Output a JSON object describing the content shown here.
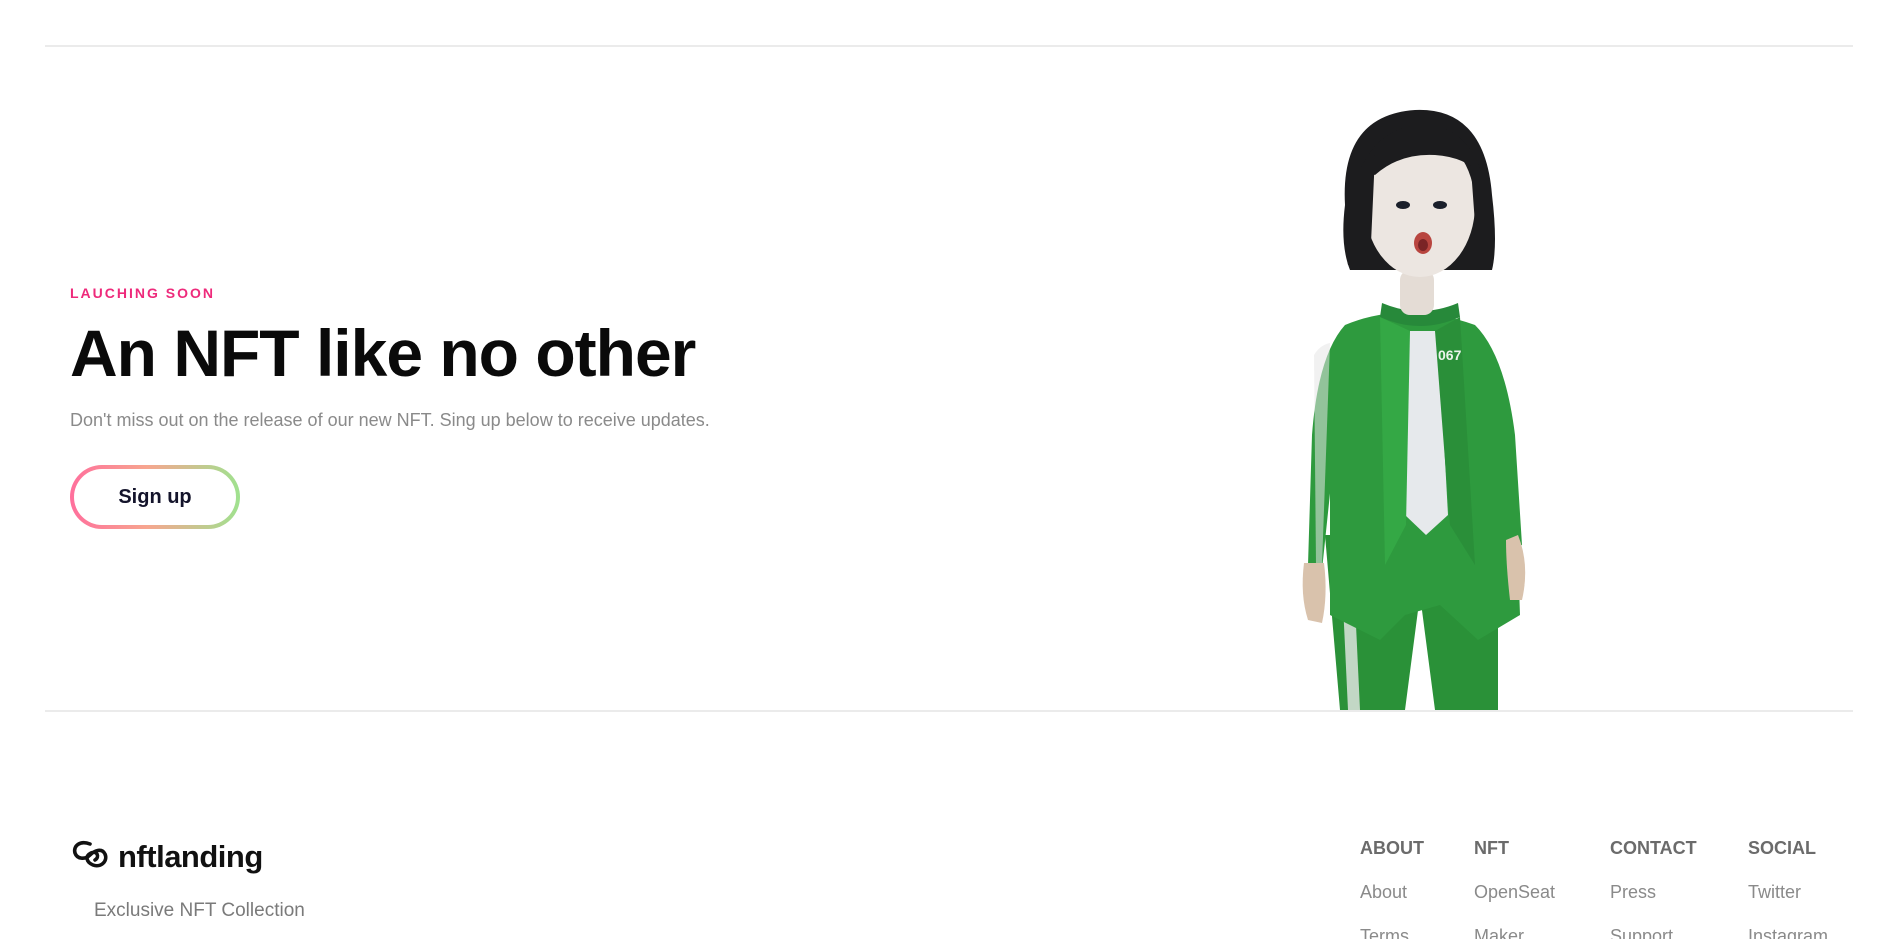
{
  "hero": {
    "eyebrow": "LAUCHING SOON",
    "headline": "An NFT like no other",
    "subtext": "Don't miss out on the release of our new NFT. Sing up below to receive updates.",
    "cta_label": "Sign up",
    "figure_badge": "067"
  },
  "footer": {
    "brand": "nftlanding",
    "tagline": "Exclusive NFT Collection",
    "columns": [
      {
        "heading": "ABOUT",
        "links": [
          "About",
          "Terms"
        ]
      },
      {
        "heading": "NFT",
        "links": [
          "OpenSeat",
          "Maker"
        ]
      },
      {
        "heading": "CONTACT",
        "links": [
          "Press",
          "Support"
        ]
      },
      {
        "heading": "SOCIAL",
        "links": [
          "Twitter",
          "Instagram"
        ]
      }
    ]
  },
  "colors": {
    "accent_pink": "#ee2a7b",
    "jacket_green": "#2e9a3e",
    "gradient_start": "#ff6f9c",
    "gradient_end": "#9fe28f"
  },
  "icons": {
    "logo": "nftlanding-logo-icon"
  }
}
